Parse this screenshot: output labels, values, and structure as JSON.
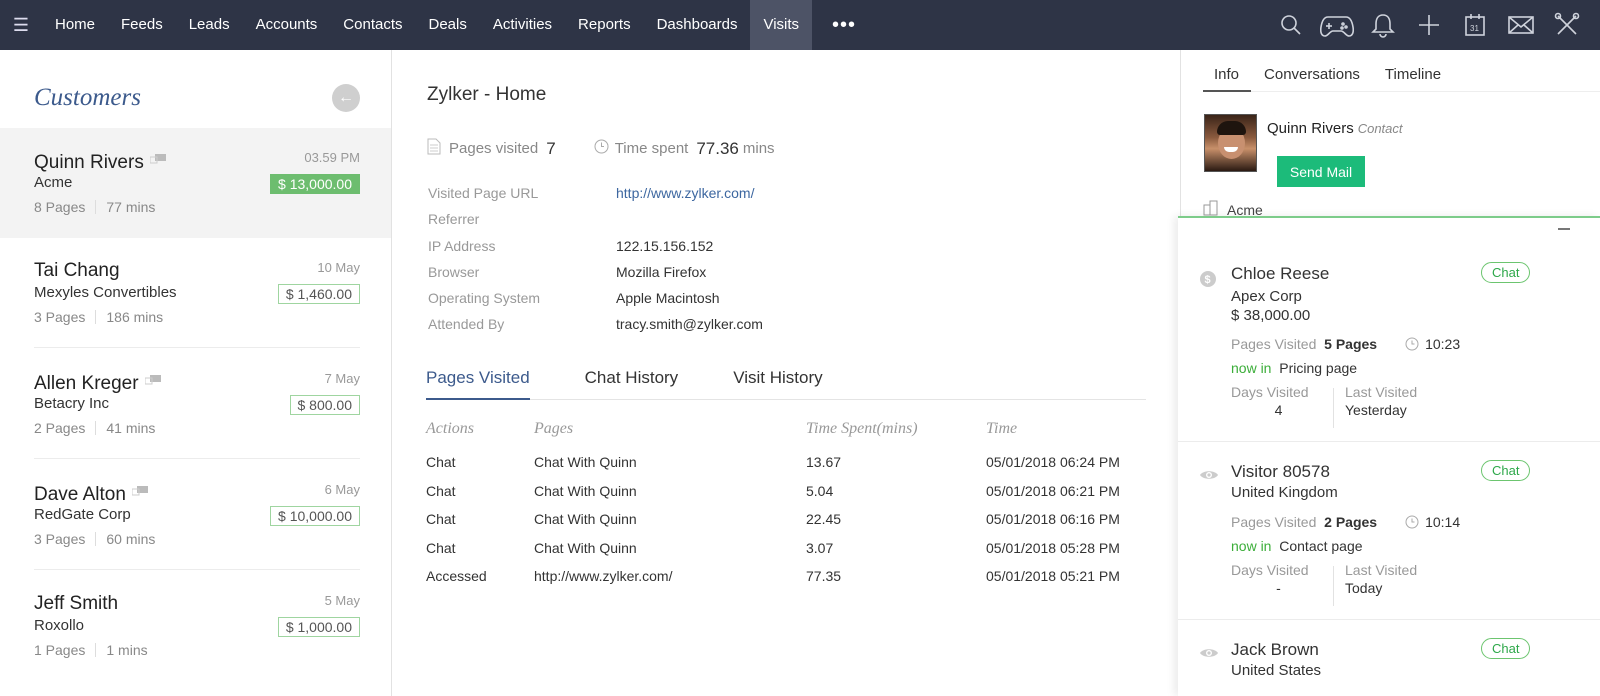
{
  "nav": {
    "items": [
      "Home",
      "Feeds",
      "Leads",
      "Accounts",
      "Contacts",
      "Deals",
      "Activities",
      "Reports",
      "Dashboards",
      "Visits"
    ],
    "active": "Visits",
    "more": "•••",
    "icons": [
      "search-icon",
      "gamepad-icon",
      "bell-icon",
      "plus-icon",
      "calendar-icon",
      "mail-icon",
      "tools-icon"
    ],
    "calendar_day": "31"
  },
  "customers": {
    "title": "Customers",
    "items": [
      {
        "name": "Quinn Rivers",
        "company": "Acme",
        "pages": "8 Pages",
        "mins": "77 mins",
        "date": "03.59 PM",
        "amount": "$ 13,000.00",
        "chat": true,
        "selected": true
      },
      {
        "name": "Tai Chang",
        "company": "Mexyles Convertibles",
        "pages": "3 Pages",
        "mins": "186 mins",
        "date": "10 May",
        "amount": "$ 1,460.00",
        "chat": false
      },
      {
        "name": "Allen Kreger",
        "company": "Betacry Inc",
        "pages": "2 Pages",
        "mins": "41 mins",
        "date": "7 May",
        "amount": "$ 800.00",
        "chat": true
      },
      {
        "name": "Dave Alton",
        "company": "RedGate Corp",
        "pages": "3 Pages",
        "mins": "60 mins",
        "date": "6 May",
        "amount": "$ 10,000.00",
        "chat": true
      },
      {
        "name": "Jeff Smith",
        "company": "Roxollo",
        "pages": "1 Pages",
        "mins": "1 mins",
        "date": "5 May",
        "amount": "$ 1,000.00",
        "chat": false
      }
    ]
  },
  "detail": {
    "title": "Zylker - Home",
    "pages_visited_label": "Pages visited",
    "pages_visited": "7",
    "time_spent_label": "Time spent",
    "time_spent": "77.36",
    "time_unit": "mins",
    "fields": [
      {
        "label": "Visited Page URL",
        "value": "http://www.zylker.com/",
        "link": true
      },
      {
        "label": "Referrer",
        "value": ""
      },
      {
        "label": "IP Address",
        "value": "122.15.156.152"
      },
      {
        "label": "Browser",
        "value": "Mozilla Firefox"
      },
      {
        "label": "Operating System",
        "value": "Apple Macintosh"
      },
      {
        "label": "Attended By",
        "value": "tracy.smith@zylker.com"
      }
    ],
    "tabs": [
      "Pages Visited",
      "Chat History",
      "Visit History"
    ],
    "active_tab": "Pages Visited",
    "columns": [
      "Actions",
      "Pages",
      "Time Spent(mins)",
      "Time"
    ],
    "rows": [
      [
        "Chat",
        "Chat With Quinn",
        "13.67",
        "05/01/2018 06:24 PM"
      ],
      [
        "Chat",
        "Chat With Quinn",
        "5.04",
        "05/01/2018 06:21 PM"
      ],
      [
        "Chat",
        "Chat With Quinn",
        "22.45",
        "05/01/2018 06:16 PM"
      ],
      [
        "Chat",
        "Chat With Quinn",
        "3.07",
        "05/01/2018 05:28 PM"
      ],
      [
        "Accessed",
        "http://www.zylker.com/",
        "77.35",
        "05/01/2018 05:21 PM"
      ]
    ]
  },
  "info": {
    "tabs": [
      "Info",
      "Conversations",
      "Timeline"
    ],
    "active_tab": "Info",
    "contact_name": "Quinn Rivers",
    "contact_type": "Contact",
    "send_mail": "Send Mail",
    "account": "Acme"
  },
  "visitors": {
    "chat_label": "Chat",
    "pages_visited_label": "Pages Visited",
    "now_in_label": "now in",
    "days_visited_label": "Days Visited",
    "last_visited_label": "Last Visited",
    "items": [
      {
        "name": "Chloe Reese",
        "icon": "dollar-icon",
        "company": "Apex Corp",
        "amount": "$ 38,000.00",
        "pages": "5 Pages",
        "time": "10:23",
        "now_in": "Pricing page",
        "days": "4",
        "last": "Yesterday"
      },
      {
        "name": "Visitor 80578",
        "icon": "eye-icon",
        "company": "United Kingdom",
        "pages": "2 Pages",
        "time": "10:14",
        "now_in": "Contact page",
        "days": "-",
        "last": "Today"
      },
      {
        "name": "Jack Brown",
        "icon": "eye-icon",
        "company": "United States"
      }
    ]
  }
}
